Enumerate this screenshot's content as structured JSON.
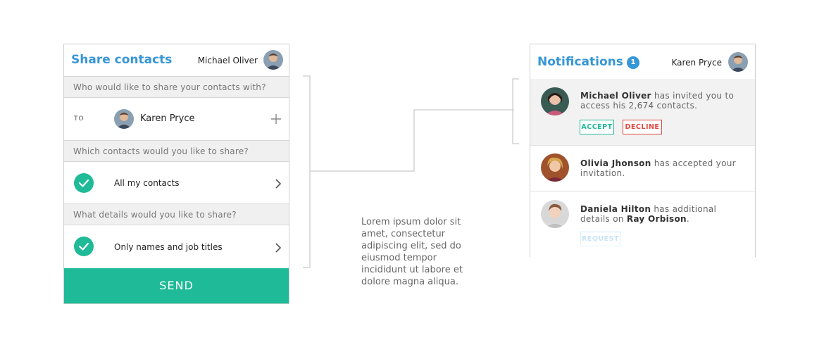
{
  "share": {
    "title": "Share contacts",
    "user_name": "Michael Oliver",
    "question_recipient": "Who would like to share your contacts with?",
    "to_label": "TO",
    "recipient_name": "Karen Pryce",
    "question_contacts": "Which contacts would you like to share?",
    "contacts_option": "All my contacts",
    "question_details": "What details would you like to share?",
    "details_option": "Only names and job titles",
    "send_label": "SEND"
  },
  "lorem": "Lorem ipsum dolor sit amet, consectetur adipiscing elit, sed do eiusmod tempor incididunt ut labore et dolore magna aliqua.",
  "notifications": {
    "title": "Notifications",
    "count": "1",
    "user_name": "Karen Pryce",
    "items": [
      {
        "name": "Michael Oliver",
        "pre": "",
        "text": " has invited you to access his 2,674 contacts.",
        "accept_label": "ACCEPT",
        "decline_label": "DECLINE"
      },
      {
        "name": "Olivia Jhonson",
        "text": " has accepted your invitation."
      },
      {
        "name": "Daniela Hilton",
        "text": " has additional details on ",
        "name2": "Ray Orbison",
        "text2": ".",
        "request_label": "REQUEST"
      }
    ]
  },
  "colors": {
    "accent_blue": "#3796d6",
    "accent_green": "#1fba97",
    "decline_red": "#e0463e"
  }
}
